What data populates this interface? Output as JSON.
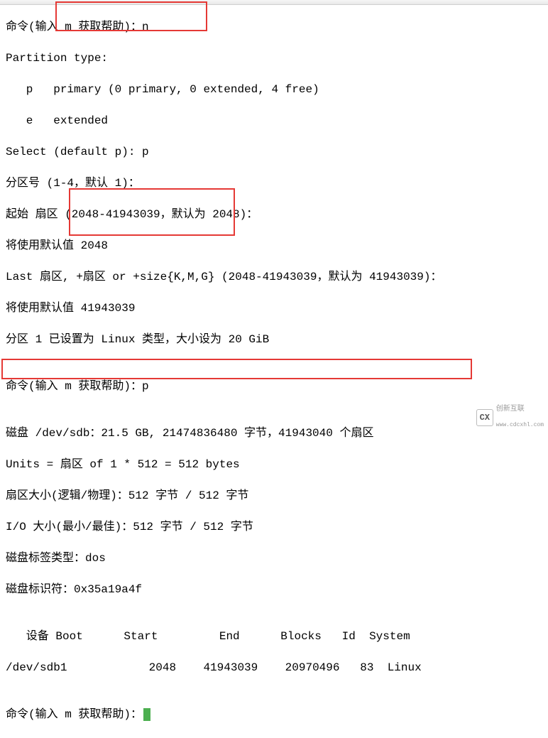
{
  "lines": {
    "l1a": "命令(输入 m 获取帮助)：",
    "l1b": "n",
    "l2": "Partition type:",
    "l3": "   p   primary (0 primary, 0 extended, 4 free)",
    "l4": "   e   extended",
    "l5a": "Select (default p): ",
    "l5b": "p",
    "l6": "分区号 (1-4，默认 1)：",
    "l7": "起始 扇区 (2048-41943039，默认为 2048)：",
    "l8": "将使用默认值 2048",
    "l9": "Last 扇区, +扇区 or +size{K,M,G} (2048-41943039，默认为 41943039)：",
    "l10": "将使用默认值 41943039",
    "l11": "分区 1 已设置为 Linux 类型，大小设为 20 GiB",
    "l12": "",
    "l13a": "命令(输入 m 获取帮助)：",
    "l13b": "p",
    "l14": "",
    "l15": "磁盘 /dev/sdb：21.5 GB, 21474836480 字节，41943040 个扇区",
    "l16": "Units = 扇区 of 1 * 512 = 512 bytes",
    "l17": "扇区大小(逻辑/物理)：512 字节 / 512 字节",
    "l18": "I/O 大小(最小/最佳)：512 字节 / 512 字节",
    "l19": "磁盘标签类型：dos",
    "l20": "磁盘标识符：0x35a19a4f",
    "l21": "",
    "l22": "   设备 Boot      Start         End      Blocks   Id  System",
    "l23": "/dev/sdb1            2048    41943039    20970496   83  Linux",
    "l24": "",
    "l25": "命令(输入 m 获取帮助)："
  },
  "watermark": {
    "brand": "创新互联",
    "url": "www.cdcxhl.com"
  }
}
